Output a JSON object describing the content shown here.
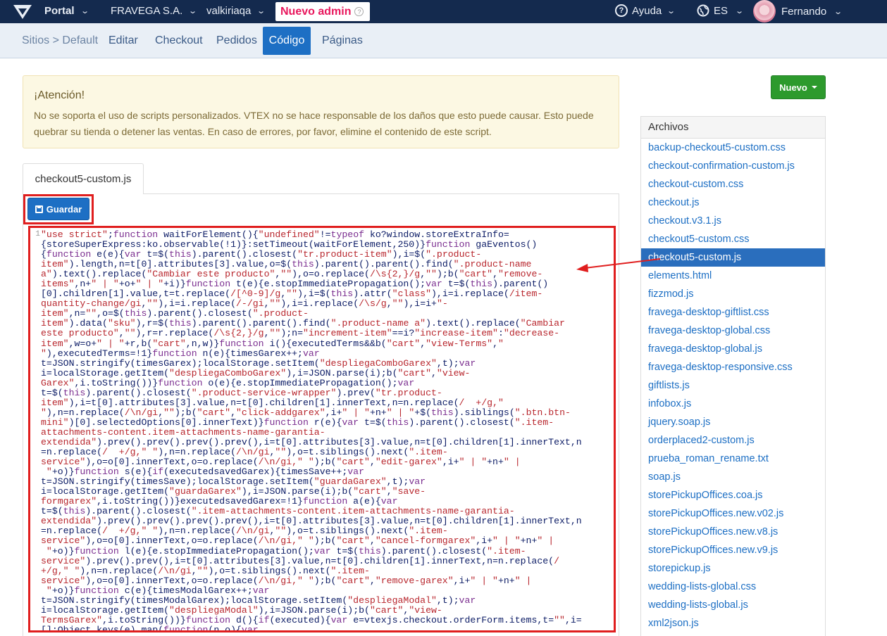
{
  "topbar": {
    "portal": "Portal",
    "account": "FRAVEGA S.A.",
    "workspace": "valkiriaqa",
    "badge": "Nuevo admin",
    "help": "Ayuda",
    "language": "ES",
    "user": "Fernando"
  },
  "subnav": {
    "breadcrumb_site": "Sitios",
    "breadcrumb_sep": ">",
    "breadcrumb_default": "Default",
    "items": [
      "Editar",
      "Checkout",
      "Pedidos",
      "Código",
      "Páginas"
    ],
    "active": "Código"
  },
  "alert": {
    "title": "¡Atención!",
    "body": "No se soporta el uso de scripts personalizados. VTEX no se hace responsable de los daños que esto puede causar. Esto puede quebrar su tienda o detener las ventas. En caso de errores, por favor, elimine el contenido de este script."
  },
  "editor": {
    "tab": "checkout5-custom.js",
    "save_label": "Guardar",
    "line_number": "1"
  },
  "sidebar": {
    "new_label": "Nuevo",
    "files_title": "Archivos",
    "files": [
      "backup-checkout5-custom.css",
      "checkout-confirmation-custom.js",
      "checkout-custom.css",
      "checkout.js",
      "checkout.v3.1.js",
      "checkout5-custom.css",
      "checkout5-custom.js",
      "elements.html",
      "fizzmod.js",
      "fravega-desktop-giftlist.css",
      "fravega-desktop-global.css",
      "fravega-desktop-global.js",
      "fravega-desktop-responsive.css",
      "giftlists.js",
      "infobox.js",
      "jquery.soap.js",
      "orderplaced2-custom.js",
      "prueba_roman_rename.txt",
      "soap.js",
      "storePickupOffices.coa.js",
      "storePickupOffices.new.v02.js",
      "storePickupOffices.new.v8.js",
      "storePickupOffices.new.v9.js",
      "storepickup.js",
      "wedding-lists-global.css",
      "wedding-lists-global.js",
      "xml2json.js"
    ],
    "active_file": "checkout5-custom.js"
  },
  "colors": {
    "topbar": "#142a4e",
    "accent": "#1d6fc4",
    "badge_text": "#e8175d",
    "highlight": "#e01e1e",
    "new_button": "#2d9a2d"
  }
}
